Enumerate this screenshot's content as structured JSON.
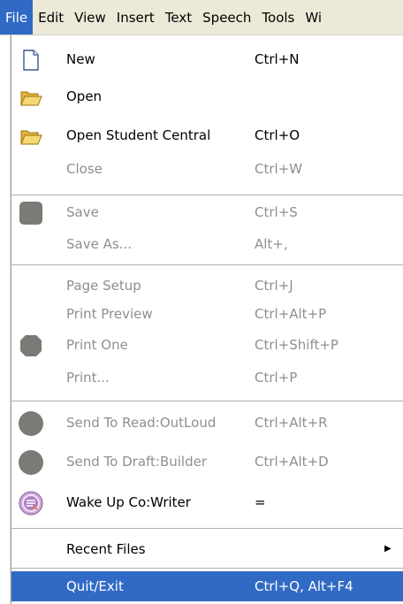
{
  "menubar": {
    "items": [
      "File",
      "Edit",
      "View",
      "Insert",
      "Text",
      "Speech",
      "Tools",
      "Wi"
    ]
  },
  "file_menu": {
    "items": [
      {
        "label": "New",
        "shortcut": "Ctrl+N",
        "icon": "new-document-icon"
      },
      {
        "label": "Open",
        "shortcut": "",
        "icon": "open-folder-icon"
      },
      {
        "label": "Open Student Central",
        "shortcut": "Ctrl+O",
        "icon": "open-folder-icon"
      },
      {
        "label": "Close",
        "shortcut": "Ctrl+W",
        "disabled": true
      },
      {
        "label": "Save",
        "shortcut": "Ctrl+S",
        "disabled": true,
        "icon": "save-icon"
      },
      {
        "label": "Save As...",
        "shortcut": "Alt+,",
        "disabled": true
      },
      {
        "label": "Page Setup",
        "shortcut": "Ctrl+J",
        "disabled": true
      },
      {
        "label": "Print Preview",
        "shortcut": "Ctrl+Alt+P",
        "disabled": true
      },
      {
        "label": "Print One",
        "shortcut": "Ctrl+Shift+P",
        "disabled": true,
        "icon": "print-one-icon"
      },
      {
        "label": "Print...",
        "shortcut": "Ctrl+P",
        "disabled": true
      },
      {
        "label": "Send To Read:OutLoud",
        "shortcut": "Ctrl+Alt+R",
        "disabled": true,
        "icon": "read-outloud-icon"
      },
      {
        "label": "Send To Draft:Builder",
        "shortcut": "Ctrl+Alt+D",
        "disabled": true,
        "icon": "draft-builder-icon"
      },
      {
        "label": "Wake Up Co:Writer",
        "shortcut": "=",
        "icon": "cowriter-icon"
      },
      {
        "label": "Recent Files",
        "shortcut": "",
        "icon": "submenu-arrow-icon"
      },
      {
        "label": "Quit/Exit",
        "shortcut": "Ctrl+Q, Alt+F4",
        "selected": true
      }
    ]
  },
  "colors": {
    "highlight": "#316ac5",
    "disabled_text": "#8f8f8f",
    "disabled_icon": "#7a7a76",
    "cowriter_icon": "#b98ac9"
  }
}
